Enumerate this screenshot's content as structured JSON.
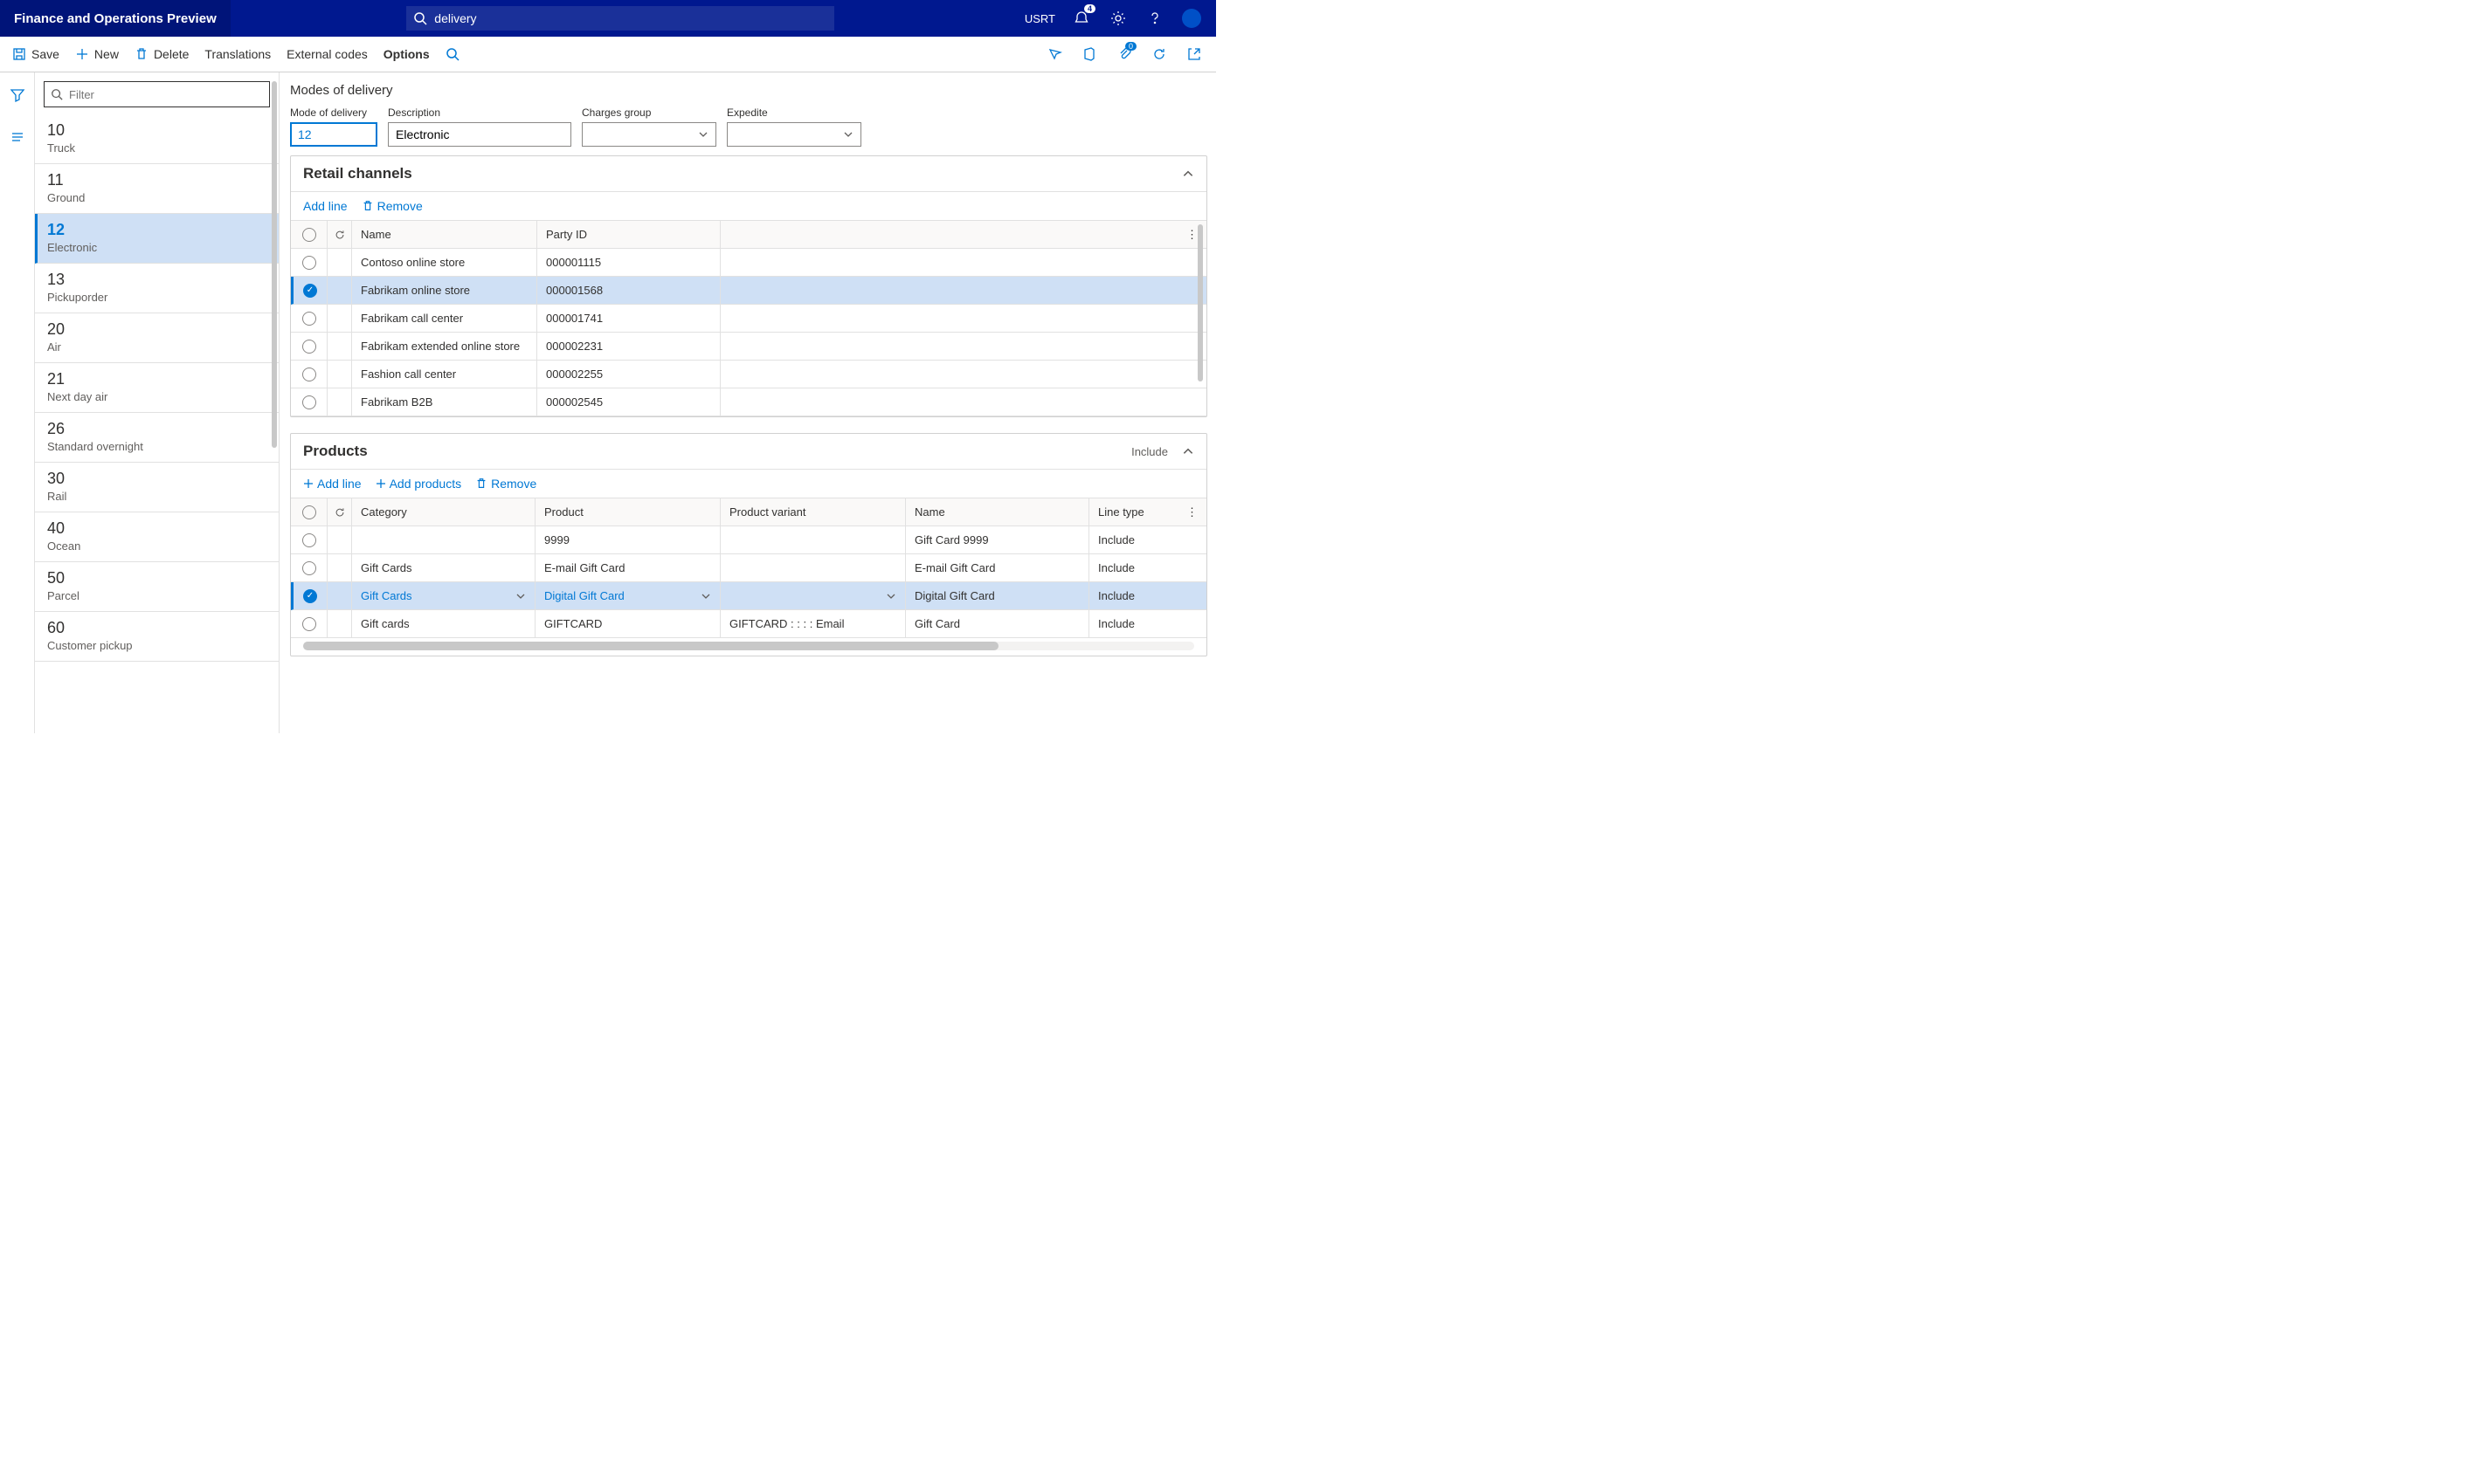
{
  "app_title": "Finance and Operations Preview",
  "search_value": "delivery",
  "user_label": "USRT",
  "notification_count": "4",
  "actions": {
    "save": "Save",
    "new": "New",
    "delete": "Delete",
    "translations": "Translations",
    "external_codes": "External codes",
    "options": "Options",
    "attach_count": "0"
  },
  "filter_placeholder": "Filter",
  "modes": [
    {
      "id": "10",
      "name": "Truck"
    },
    {
      "id": "11",
      "name": "Ground"
    },
    {
      "id": "12",
      "name": "Electronic",
      "selected": true
    },
    {
      "id": "13",
      "name": "Pickuporder"
    },
    {
      "id": "20",
      "name": "Air"
    },
    {
      "id": "21",
      "name": "Next day air"
    },
    {
      "id": "26",
      "name": "Standard overnight"
    },
    {
      "id": "30",
      "name": "Rail"
    },
    {
      "id": "40",
      "name": "Ocean"
    },
    {
      "id": "50",
      "name": "Parcel"
    },
    {
      "id": "60",
      "name": "Customer pickup"
    }
  ],
  "page_title": "Modes of delivery",
  "form": {
    "mode_label": "Mode of delivery",
    "mode_value": "12",
    "desc_label": "Description",
    "desc_value": "Electronic",
    "charges_label": "Charges group",
    "charges_value": "",
    "expedite_label": "Expedite",
    "expedite_value": ""
  },
  "retail": {
    "title": "Retail channels",
    "add_line": "Add line",
    "remove": "Remove",
    "col_name": "Name",
    "col_party": "Party ID",
    "rows": [
      {
        "name": "Contoso online store",
        "party": "000001115"
      },
      {
        "name": "Fabrikam online store",
        "party": "000001568",
        "selected": true
      },
      {
        "name": "Fabrikam call center",
        "party": "000001741"
      },
      {
        "name": "Fabrikam extended online store",
        "party": "000002231"
      },
      {
        "name": "Fashion call center",
        "party": "000002255"
      },
      {
        "name": "Fabrikam B2B",
        "party": "000002545"
      }
    ]
  },
  "products": {
    "title": "Products",
    "include_label": "Include",
    "add_line": "Add line",
    "add_products": "Add products",
    "remove": "Remove",
    "col_category": "Category",
    "col_product": "Product",
    "col_variant": "Product variant",
    "col_name": "Name",
    "col_linetype": "Line type",
    "rows": [
      {
        "category": "",
        "product": "9999",
        "variant": "",
        "name": "Gift Card 9999",
        "linetype": "Include"
      },
      {
        "category": "Gift Cards",
        "product": "E-mail Gift Card",
        "variant": "",
        "name": "E-mail Gift Card",
        "linetype": "Include"
      },
      {
        "category": "Gift Cards",
        "product": "Digital Gift Card",
        "variant": "",
        "name": "Digital Gift Card",
        "linetype": "Include",
        "selected": true
      },
      {
        "category": "Gift cards",
        "product": "GIFTCARD",
        "variant": "GIFTCARD :  :  :  : Email",
        "name": "Gift Card",
        "linetype": "Include"
      }
    ]
  }
}
